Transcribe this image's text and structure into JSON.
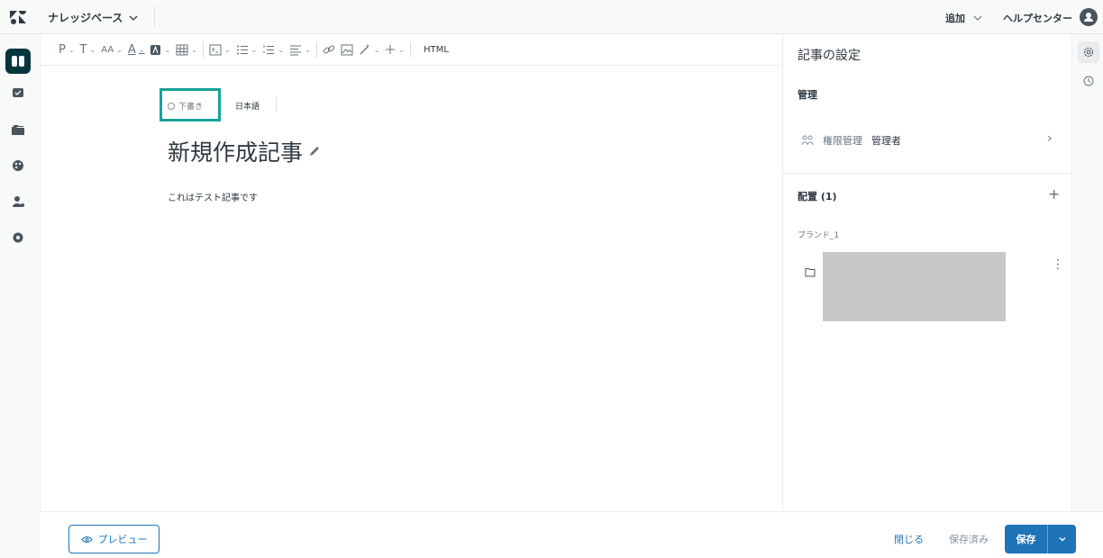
{
  "topbar": {
    "product_name": "ナレッジベース",
    "add_label": "追加",
    "help_center_label": "ヘルプセンター"
  },
  "toolbar": {
    "paragraph": "P",
    "text_style": "T",
    "font_size": "AA",
    "font_color": "A",
    "html_label": "HTML"
  },
  "article": {
    "status": "下書き",
    "language": "日本語",
    "title": "新規作成記事",
    "body": "これはテスト記事です"
  },
  "settings": {
    "title": "記事の設定",
    "manage_heading": "管理",
    "permission_label": "権限管理",
    "permission_value": "管理者",
    "placement_heading": "配置 (1)",
    "brand_label": "ブランド_1"
  },
  "footer": {
    "preview_label": "プレビュー",
    "close_label": "閉じる",
    "saved_label": "保存済み",
    "save_label": "保存"
  },
  "colors": {
    "accent_blue": "#1f73b7",
    "highlight_teal": "#15a398",
    "nav_dark": "#03363d"
  }
}
